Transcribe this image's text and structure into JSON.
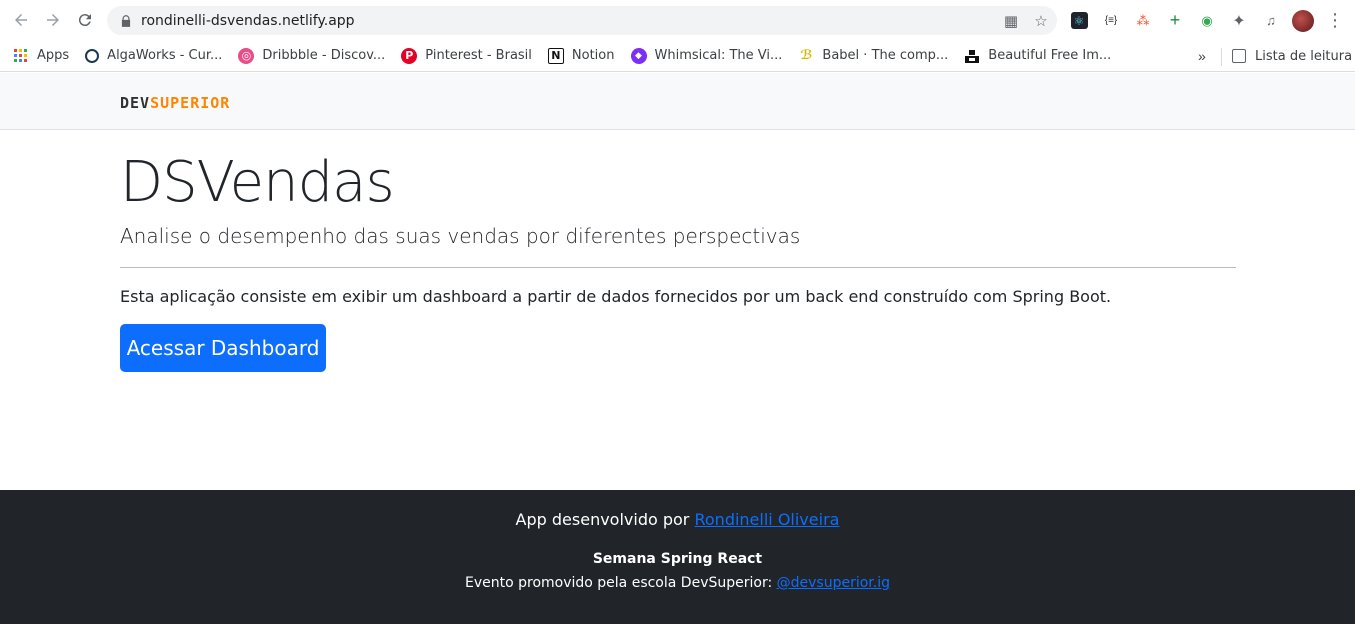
{
  "browser": {
    "url": "rondinelli-dsvendas.netlify.app",
    "bookmarks": [
      {
        "label": "Apps",
        "icon": "apps-grid-icon"
      },
      {
        "label": "AlgaWorks - Cur...",
        "icon": "algaworks-icon"
      },
      {
        "label": "Dribbble - Discov...",
        "icon": "dribbble-icon"
      },
      {
        "label": "Pinterest - Brasil",
        "icon": "pinterest-icon"
      },
      {
        "label": "Notion",
        "icon": "notion-icon"
      },
      {
        "label": "Whimsical: The Vi...",
        "icon": "whimsical-icon"
      },
      {
        "label": "Babel · The comp...",
        "icon": "babel-icon"
      },
      {
        "label": "Beautiful Free Im...",
        "icon": "unsplash-icon"
      }
    ],
    "more_bookmarks": "»",
    "reading_list": "Lista de leitura"
  },
  "header": {
    "logo_dev": "DEV",
    "logo_superior": "SUPERIOR"
  },
  "main": {
    "title": "DSVendas",
    "lead": "Analise o desempenho das suas vendas por diferentes perspectivas",
    "description": "Esta aplicação consiste em exibir um dashboard a partir de dados fornecidos por um back end construído com Spring Boot.",
    "cta_label": "Acessar Dashboard"
  },
  "footer": {
    "dev_prefix": "App desenvolvido por",
    "dev_name": "Rondinelli Oliveira",
    "event_title": "Semana Spring React",
    "event_prefix": "Evento promovido pela escola DevSuperior:",
    "event_link": "@devsuperior.ig"
  },
  "colors": {
    "primary": "#0d6efd",
    "logo_orange": "#ff8400",
    "footer_bg": "#212529",
    "header_bg": "#f8f9fa"
  }
}
